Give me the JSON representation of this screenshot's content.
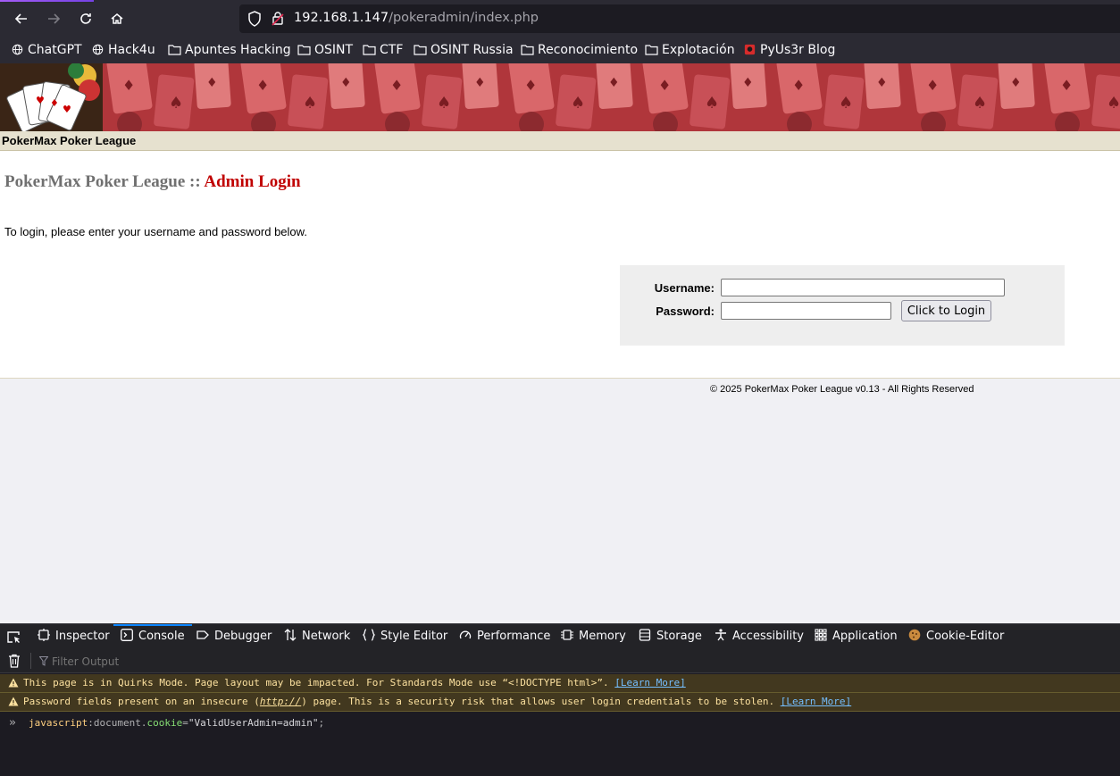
{
  "browser": {
    "url_host": "192.168.1.147",
    "url_path": "/pokeradmin/index.php",
    "bookmarks": [
      {
        "label": "ChatGPT",
        "icon": "globe-icon"
      },
      {
        "label": "Hack4u",
        "icon": "globe-icon"
      },
      {
        "label": "Apuntes Hacking",
        "icon": "folder-icon"
      },
      {
        "label": "OSINT",
        "icon": "folder-icon"
      },
      {
        "label": "CTF",
        "icon": "folder-icon"
      },
      {
        "label": "OSINT Russia",
        "icon": "folder-icon"
      },
      {
        "label": "Reconocimiento",
        "icon": "folder-icon"
      },
      {
        "label": "Explotación",
        "icon": "folder-icon"
      },
      {
        "label": "PyUs3r Blog",
        "icon": "site-favicon"
      }
    ]
  },
  "page": {
    "site_name": "PokerMax Poker League",
    "title_main": "PokerMax Poker League :: ",
    "title_sub": "Admin Login",
    "intro": "To login, please enter your username and password below.",
    "form": {
      "username_label": "Username:",
      "username_value": "",
      "password_label": "Password:",
      "password_value": "",
      "submit_label": "Click to Login"
    },
    "footer": "© 2025 PokerMax Poker League v0.13 - All Rights Reserved"
  },
  "devtools": {
    "tabs": [
      {
        "label": "Inspector",
        "icon": "inspector-icon"
      },
      {
        "label": "Console",
        "icon": "console-icon",
        "active": true
      },
      {
        "label": "Debugger",
        "icon": "debugger-icon"
      },
      {
        "label": "Network",
        "icon": "network-icon"
      },
      {
        "label": "Style Editor",
        "icon": "style-editor-icon"
      },
      {
        "label": "Performance",
        "icon": "performance-icon"
      },
      {
        "label": "Memory",
        "icon": "memory-icon"
      },
      {
        "label": "Storage",
        "icon": "storage-icon"
      },
      {
        "label": "Accessibility",
        "icon": "accessibility-icon"
      },
      {
        "label": "Application",
        "icon": "application-icon"
      },
      {
        "label": "Cookie-Editor",
        "icon": "cookie-icon"
      }
    ],
    "filter_placeholder": "Filter Output",
    "warnings": [
      {
        "before": "This page is in Quirks Mode. Page layout may be impacted. For Standards Mode use “<!DOCTYPE html>”. ",
        "em": "",
        "after": "",
        "link": "[Learn More]"
      },
      {
        "before": "Password fields present on an insecure (",
        "em": "http://",
        "after": ") page. This is a security risk that allows user login credentials to be stolen. ",
        "link": "[Learn More]"
      }
    ],
    "input": {
      "prefix": "javascript",
      "colon": ":",
      "object": "document",
      "dot": ".",
      "property": "cookie",
      "equals": "=",
      "string": "\"ValidUserAdmin=admin\"",
      "end": ";"
    }
  },
  "colors": {
    "title_accent": "#c00000",
    "title_gray": "#707070",
    "banner_red": "#b33a3a",
    "subbar_beige": "#e6e1cf",
    "devtools_active": "#0a84ff"
  }
}
